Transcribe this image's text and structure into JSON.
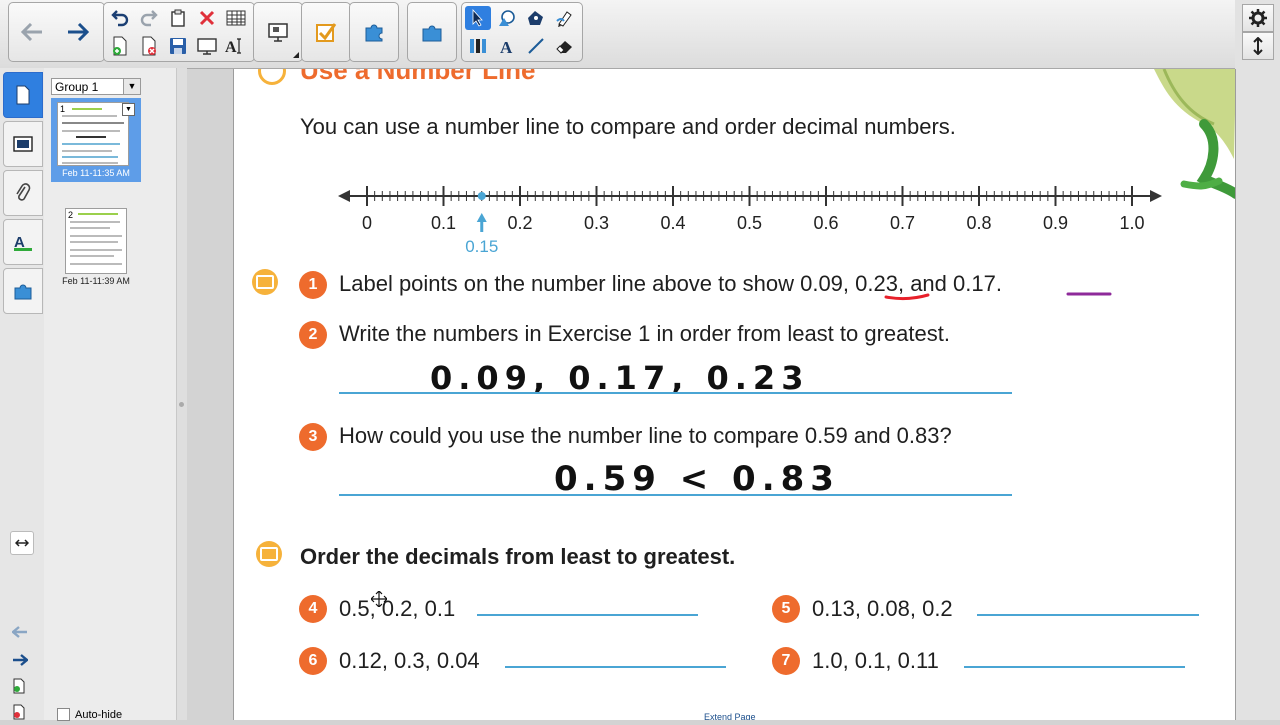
{
  "toolbar": {
    "buttons": [
      "back-arrow",
      "forward-arrow",
      "undo",
      "redo",
      "paste",
      "delete",
      "table",
      "add-page",
      "delete-page",
      "save",
      "screen-shade",
      "text-tools",
      "display",
      "check",
      "puzzle",
      "add-ons",
      "select",
      "shapes",
      "fill",
      "pen",
      "measure",
      "text",
      "line",
      "eraser"
    ],
    "accent": "#2f7fe0"
  },
  "sidebar": {
    "group_label": "Group 1",
    "pages": [
      {
        "number": "1",
        "caption": "Feb 11-11:35 AM"
      },
      {
        "number": "2",
        "caption": "Feb 11-11:39 AM"
      }
    ],
    "auto_hide_label": "Auto-hide"
  },
  "lesson": {
    "heading": "Use a Number Line",
    "intro": "You can use a number line to compare and order decimal numbers.",
    "number_line": {
      "ticks": [
        "0",
        "0.1",
        "0.2",
        "0.3",
        "0.4",
        "0.5",
        "0.6",
        "0.7",
        "0.8",
        "0.9",
        "1.0"
      ],
      "marker_value": 0.15,
      "marker_label": "0.15"
    },
    "exercises": [
      {
        "num": "1",
        "text_a": "Label points on the number line above to show ",
        "v1": "0.09",
        "mid": ", 0.23, and ",
        "v2": "0.17."
      },
      {
        "num": "2",
        "text": "Write the numbers in Exercise 1 in order from least to greatest."
      },
      {
        "num": "3",
        "text": "How could you use the number line to compare 0.59 and 0.83?"
      }
    ],
    "handwriting": {
      "answer2": "0.09, 0.17, 0.23",
      "answer3": "0.59 < 0.83"
    },
    "order_heading": "Order the decimals from least to greatest.",
    "order_items": [
      {
        "num": "4",
        "text": "0.5, 0.2, 0.1"
      },
      {
        "num": "5",
        "text": "0.13, 0.08, 0.2"
      },
      {
        "num": "6",
        "text": "0.12, 0.3, 0.04"
      },
      {
        "num": "7",
        "text": "1.0, 0.1, 0.11"
      }
    ],
    "extend_page": "Extend Page",
    "colors": {
      "orange": "#ee6b2d",
      "blue": "#4aa5d4",
      "underline_red": "#e8202a",
      "underline_purple": "#8e2a9a"
    }
  }
}
